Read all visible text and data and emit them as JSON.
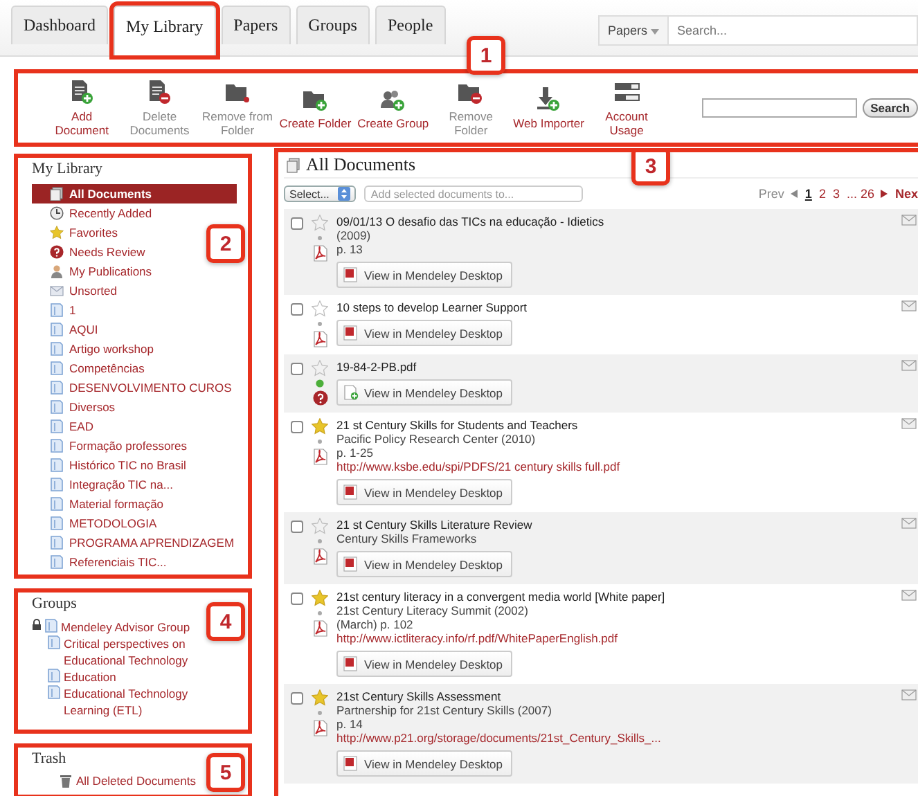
{
  "tabs": [
    {
      "label": "Dashboard",
      "selected": false,
      "annotated": false
    },
    {
      "label": "My Library",
      "selected": true,
      "annotated": true
    },
    {
      "label": "Papers",
      "selected": false,
      "annotated": false
    },
    {
      "label": "Groups",
      "selected": false,
      "annotated": false
    },
    {
      "label": "People",
      "selected": false,
      "annotated": false
    }
  ],
  "search": {
    "scope": "Papers",
    "placeholder": "Search..."
  },
  "toolbar": {
    "callout": "1",
    "button": "Search",
    "items": [
      {
        "label": "Add Document",
        "kind": "add",
        "enabled": true
      },
      {
        "label": "Delete Documents",
        "kind": "delete",
        "enabled": false
      },
      {
        "label": "Remove from Folder",
        "kind": "unfile",
        "enabled": false
      },
      {
        "label": "Create Folder",
        "kind": "folder",
        "enabled": true
      },
      {
        "label": "Create Group",
        "kind": "group",
        "enabled": true
      },
      {
        "label": "Remove Folder",
        "kind": "remove",
        "enabled": false
      },
      {
        "label": "Web Importer",
        "kind": "import",
        "enabled": true
      },
      {
        "label": "Account Usage",
        "kind": "usage",
        "enabled": true
      }
    ]
  },
  "library": {
    "title": "My Library",
    "callout": "2",
    "items": [
      {
        "label": "All Documents",
        "kind": "all",
        "selected": true
      },
      {
        "label": "Recently Added",
        "kind": "recent",
        "selected": false
      },
      {
        "label": "Favorites",
        "kind": "favorites",
        "selected": false
      },
      {
        "label": "Needs Review",
        "kind": "review",
        "selected": false
      },
      {
        "label": "My Publications",
        "kind": "publications",
        "selected": false
      },
      {
        "label": "Unsorted",
        "kind": "unsorted",
        "selected": false
      },
      {
        "label": "1",
        "kind": "folder",
        "selected": false
      },
      {
        "label": "AQUI",
        "kind": "folder",
        "selected": false
      },
      {
        "label": "Artigo workshop",
        "kind": "folder",
        "selected": false
      },
      {
        "label": "Competências",
        "kind": "folder",
        "selected": false
      },
      {
        "label": "DESENVOLVIMENTO CUROS",
        "kind": "folder",
        "selected": false
      },
      {
        "label": "Diversos",
        "kind": "folder",
        "selected": false
      },
      {
        "label": "EAD",
        "kind": "folder",
        "selected": false
      },
      {
        "label": "Formação professores",
        "kind": "folder",
        "selected": false
      },
      {
        "label": "Histórico TIC no Brasil",
        "kind": "folder",
        "selected": false
      },
      {
        "label": "Integração TIC na...",
        "kind": "folder",
        "selected": false
      },
      {
        "label": "Material formação",
        "kind": "folder",
        "selected": false
      },
      {
        "label": "METODOLOGIA",
        "kind": "folder",
        "selected": false
      },
      {
        "label": "PROGRAMA APRENDIZAGEM",
        "kind": "folder",
        "selected": false
      },
      {
        "label": "Referenciais TIC...",
        "kind": "folder",
        "selected": false
      }
    ]
  },
  "groups": {
    "title": "Groups",
    "callout": "4",
    "items": [
      {
        "label": "Mendeley Advisor Group",
        "locked": true
      },
      {
        "label": "Critical perspectives on Educational Technology",
        "locked": false
      },
      {
        "label": "Education",
        "locked": false
      },
      {
        "label": "Educational Technology Learning (ETL)",
        "locked": false
      }
    ]
  },
  "trash": {
    "title": "Trash",
    "callout": "5",
    "items": [
      {
        "label": "All Deleted Documents"
      }
    ]
  },
  "documents": {
    "title": "All Documents",
    "callout": "3",
    "select": "Select...",
    "add_to": "Add selected documents to...",
    "pagination": {
      "prev": "Prev",
      "next": "Nex",
      "pages": [
        {
          "label": "1",
          "selected": true
        },
        {
          "label": "2",
          "selected": false
        },
        {
          "label": "3",
          "selected": false
        },
        {
          "label": "... 26",
          "selected": false
        }
      ]
    },
    "rows": [
      {
        "title": "09/01/13 O desafio das TICs na educação - Idietics",
        "checked": false,
        "starred": false,
        "unread": false,
        "kind": "pdf",
        "button": "View in Mendeley Desktop",
        "lines": [
          {
            "text": "(2009)",
            "kind": "plain"
          },
          {
            "text": "p. 13",
            "kind": "plain"
          }
        ]
      },
      {
        "title": "10 steps to develop Learner Support",
        "checked": false,
        "starred": false,
        "unread": false,
        "kind": "pdf",
        "button": "View in Mendeley Desktop",
        "lines": []
      },
      {
        "title": "19-84-2-PB.pdf",
        "checked": false,
        "starred": false,
        "unread": true,
        "kind": "review",
        "button": "View in Mendeley Desktop",
        "lines": []
      },
      {
        "title": "21 st Century Skills for Students and Teachers",
        "checked": false,
        "starred": true,
        "unread": false,
        "kind": "pdf",
        "button": "View in Mendeley Desktop",
        "lines": [
          {
            "text": "Pacific Policy Research Center (2010)",
            "kind": "plain"
          },
          {
            "text": "p. 1-25",
            "kind": "plain"
          },
          {
            "text": "http://www.ksbe.edu/spi/PDFS/21 century skills full.pdf",
            "kind": "link"
          }
        ]
      },
      {
        "title": "21 st Century Skills Literature Review",
        "checked": false,
        "starred": false,
        "unread": false,
        "kind": "pdf",
        "button": "View in Mendeley Desktop",
        "lines": [
          {
            "text": "Century Skills Frameworks",
            "kind": "plain"
          }
        ]
      },
      {
        "title": "21st century literacy in a convergent media world [White paper]",
        "checked": false,
        "starred": true,
        "unread": false,
        "kind": "pdf",
        "button": "View in Mendeley Desktop",
        "lines": [
          {
            "text": "21st Century Literacy Summit (2002)",
            "kind": "plain"
          },
          {
            "text": "(March) p. 102",
            "kind": "plain"
          },
          {
            "text": "http://www.ictliteracy.info/rf.pdf/WhitePaperEnglish.pdf",
            "kind": "link"
          }
        ]
      },
      {
        "title": "21st Century Skills Assessment",
        "checked": false,
        "starred": true,
        "unread": false,
        "kind": "pdf",
        "button": "View in Mendeley Desktop",
        "lines": [
          {
            "text": "Partnership for 21st Century Skills (2007)",
            "kind": "plain"
          },
          {
            "text": "p. 14",
            "kind": "plain"
          },
          {
            "text": "http://www.p21.org/storage/documents/21st_Century_Skills_...",
            "kind": "link"
          }
        ]
      }
    ]
  }
}
